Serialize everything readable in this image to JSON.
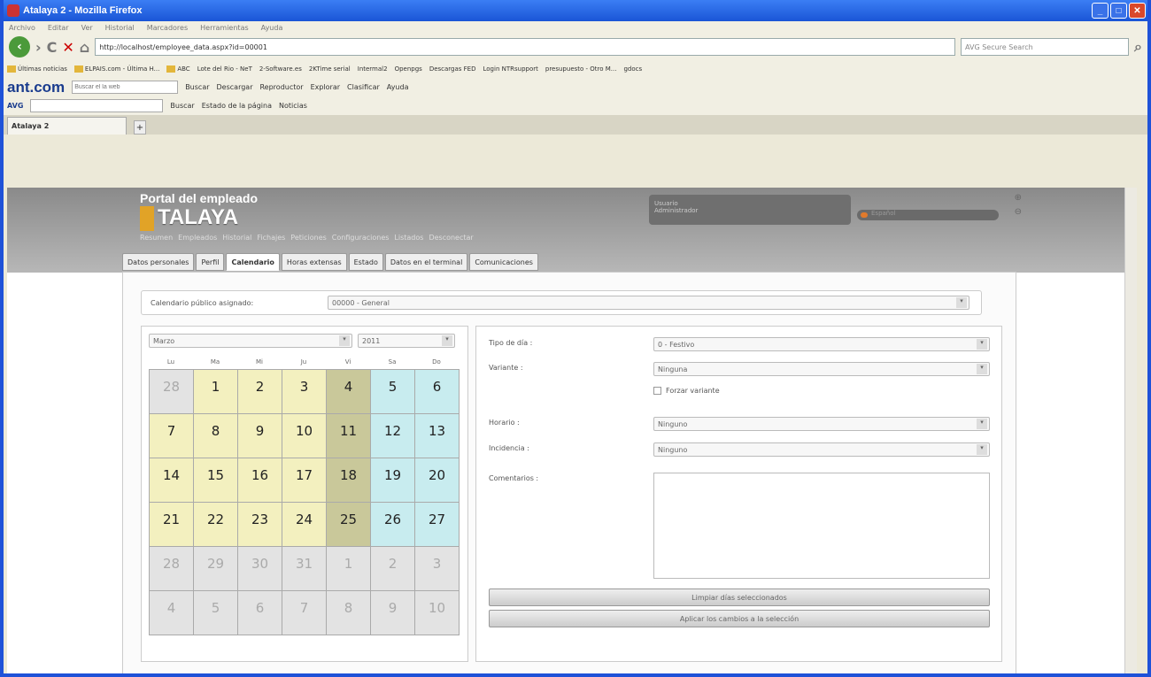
{
  "window": {
    "title": "Atalaya 2 - Mozilla Firefox"
  },
  "menu": [
    "Archivo",
    "Editar",
    "Ver",
    "Historial",
    "Marcadores",
    "Herramientas",
    "Ayuda"
  ],
  "nav": {
    "url": "http://localhost/employee_data.aspx?id=00001",
    "search_placeholder": "AVG Secure Search"
  },
  "bookmarks": [
    "Últimas noticias",
    "ELPAIS.com - Última H...",
    "ABC",
    "Lote del Rio - NeT",
    "2-Software.es",
    "2KTime serial",
    "Intermal2",
    "Openpgs",
    "Descargas FED",
    "Login NTRsupport",
    "presupuesto - Otro M...",
    "gdocs"
  ],
  "anttoolbar": {
    "brand": "ant.com",
    "search_placeholder": "Buscar el la web",
    "buttons": [
      "Buscar",
      "Descargar",
      "Reproductor",
      "Explorar",
      "Clasificar",
      "Ayuda"
    ]
  },
  "avgtoolbar": {
    "brand": "AVG",
    "buttons": [
      "Buscar",
      "Estado de la página",
      "Noticias"
    ]
  },
  "tab": {
    "label": "Atalaya 2"
  },
  "app": {
    "portal_title": "Portal del empleado",
    "brand": "TALAYA",
    "user_box": [
      "Usuario",
      "Administrador"
    ],
    "language": "Español",
    "menu": [
      "Resumen",
      "Empleados",
      "Historial",
      "Fichajes",
      "Peticiones",
      "Configuraciones",
      "Listados",
      "Desconectar"
    ],
    "subtabs": [
      "Datos personales",
      "Perfil",
      "Calendario",
      "Horas extensas",
      "Estado",
      "Datos en el terminal",
      "Comunicaciones"
    ],
    "public_calendar_label": "Calendario público asignado:",
    "public_calendar_value": "00000 - General",
    "month": "Marzo",
    "year": "2011",
    "dows": [
      "Lu",
      "Ma",
      "Mi",
      "Ju",
      "Vi",
      "Sa",
      "Do"
    ],
    "days": [
      [
        "28",
        "g"
      ],
      [
        "1",
        "y"
      ],
      [
        "2",
        "y"
      ],
      [
        "3",
        "y"
      ],
      [
        "4",
        "o"
      ],
      [
        "5",
        "b"
      ],
      [
        "6",
        "b"
      ],
      [
        "7",
        "y"
      ],
      [
        "8",
        "y"
      ],
      [
        "9",
        "y"
      ],
      [
        "10",
        "y"
      ],
      [
        "11",
        "o"
      ],
      [
        "12",
        "b"
      ],
      [
        "13",
        "b"
      ],
      [
        "14",
        "y"
      ],
      [
        "15",
        "y"
      ],
      [
        "16",
        "y"
      ],
      [
        "17",
        "y"
      ],
      [
        "18",
        "o"
      ],
      [
        "19",
        "b"
      ],
      [
        "20",
        "b"
      ],
      [
        "21",
        "y"
      ],
      [
        "22",
        "y"
      ],
      [
        "23",
        "y"
      ],
      [
        "24",
        "y"
      ],
      [
        "25",
        "o"
      ],
      [
        "26",
        "b"
      ],
      [
        "27",
        "b"
      ],
      [
        "28",
        "g"
      ],
      [
        "29",
        "g"
      ],
      [
        "30",
        "g"
      ],
      [
        "31",
        "g"
      ],
      [
        "1",
        "g"
      ],
      [
        "2",
        "g"
      ],
      [
        "3",
        "g"
      ],
      [
        "4",
        "g"
      ],
      [
        "5",
        "g"
      ],
      [
        "6",
        "g"
      ],
      [
        "7",
        "g"
      ],
      [
        "8",
        "g"
      ],
      [
        "9",
        "g"
      ],
      [
        "10",
        "g"
      ]
    ],
    "day_type_label": "Tipo de día :",
    "day_type_value": "0 - Festivo",
    "variant_label": "Variante :",
    "variant_value": "Ninguna",
    "force_variant": "Forzar variante",
    "schedule_label": "Horario :",
    "schedule_value": "Ninguno",
    "incidence_label": "Incidencia :",
    "incidence_value": "Ninguno",
    "comments_label": "Comentarios :",
    "btn_reset": "Limpiar días seleccionados",
    "btn_apply": "Aplicar los cambios a la selección"
  }
}
